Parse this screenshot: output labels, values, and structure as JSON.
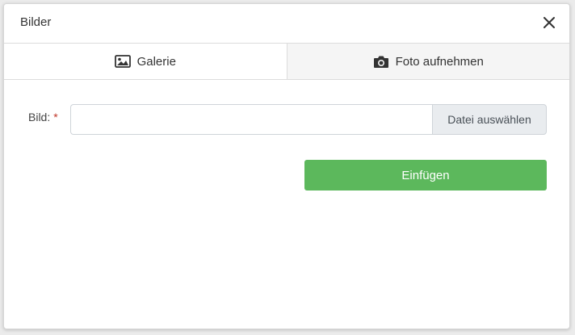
{
  "dialog": {
    "title": "Bilder"
  },
  "tabs": [
    {
      "label": "Galerie",
      "icon": "image-icon",
      "active": true
    },
    {
      "label": "Foto aufnehmen",
      "icon": "camera-icon",
      "active": false
    }
  ],
  "form": {
    "field_label": "Bild:",
    "required_marker": "*",
    "file_value": "",
    "file_button_label": "Datei auswählen"
  },
  "actions": {
    "submit_label": "Einfügen"
  },
  "colors": {
    "submit_bg": "#5cb85c",
    "required": "#c0392b",
    "file_button_bg": "#e9ecef",
    "inactive_tab_bg": "#f5f5f5"
  }
}
